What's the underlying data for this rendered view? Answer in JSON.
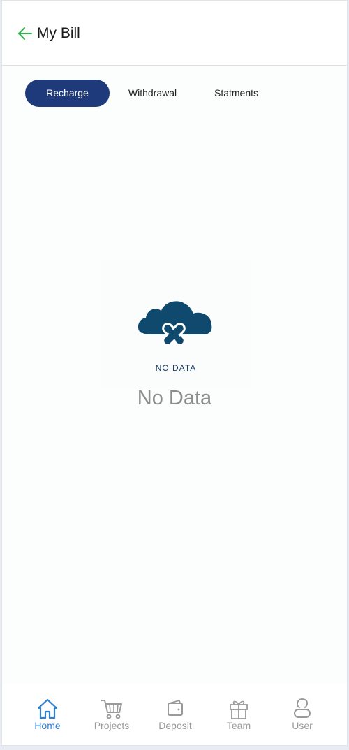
{
  "header": {
    "title": "My Bill",
    "back_icon": "arrow-left-icon",
    "back_color": "#2db34a"
  },
  "tabs": [
    {
      "label": "Recharge",
      "active": true
    },
    {
      "label": "Withdrawal",
      "active": false
    },
    {
      "label": "Statments",
      "active": false
    }
  ],
  "accent_color": "#1e3a7a",
  "empty_state": {
    "illustration_icon": "cloud-cross-icon",
    "illustration_caption": "NO DATA",
    "message": "No Data"
  },
  "bottom_nav": {
    "active_color": "#2f80d1",
    "inactive_color": "#9a9a9a",
    "items": [
      {
        "label": "Home",
        "icon": "home-icon",
        "active": true
      },
      {
        "label": "Projects",
        "icon": "cart-icon",
        "active": false
      },
      {
        "label": "Deposit",
        "icon": "wallet-icon",
        "active": false
      },
      {
        "label": "Team",
        "icon": "gift-icon",
        "active": false
      },
      {
        "label": "User",
        "icon": "user-icon",
        "active": false
      }
    ]
  }
}
